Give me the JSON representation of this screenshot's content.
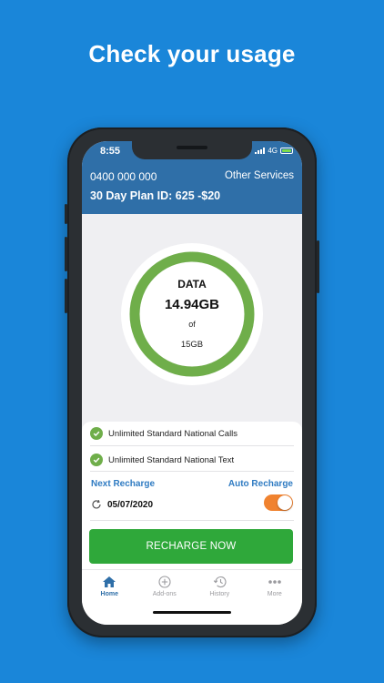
{
  "headline": "Check your usage",
  "status": {
    "time": "8:55",
    "network": "4G"
  },
  "account": {
    "phone_number": "0400 000 000",
    "other_services": "Other Services",
    "plan": "30 Day Plan ID: 625 -$20"
  },
  "usage": {
    "label": "DATA",
    "remaining": "14.94GB",
    "of": "of",
    "total": "15GB",
    "remaining_fraction": 0.996
  },
  "features": [
    "Unlimited Standard National Calls",
    "Unlimited Standard National Text"
  ],
  "recharge": {
    "next_label": "Next Recharge",
    "auto_label": "Auto Recharge",
    "date": "05/07/2020",
    "auto_enabled": true,
    "button_label": "RECHARGE NOW"
  },
  "tabs": [
    {
      "label": "Home",
      "icon": "home-icon",
      "active": true
    },
    {
      "label": "Add-ons",
      "icon": "plus-circle-icon",
      "active": false
    },
    {
      "label": "History",
      "icon": "history-icon",
      "active": false
    },
    {
      "label": "More",
      "icon": "more-dots-icon",
      "active": false
    }
  ],
  "colors": {
    "background": "#1a86d9",
    "header": "#2f6fa8",
    "ring": "#6fae4a",
    "button": "#2fa83a",
    "toggle": "#f0822f",
    "link": "#2f7bc2"
  }
}
